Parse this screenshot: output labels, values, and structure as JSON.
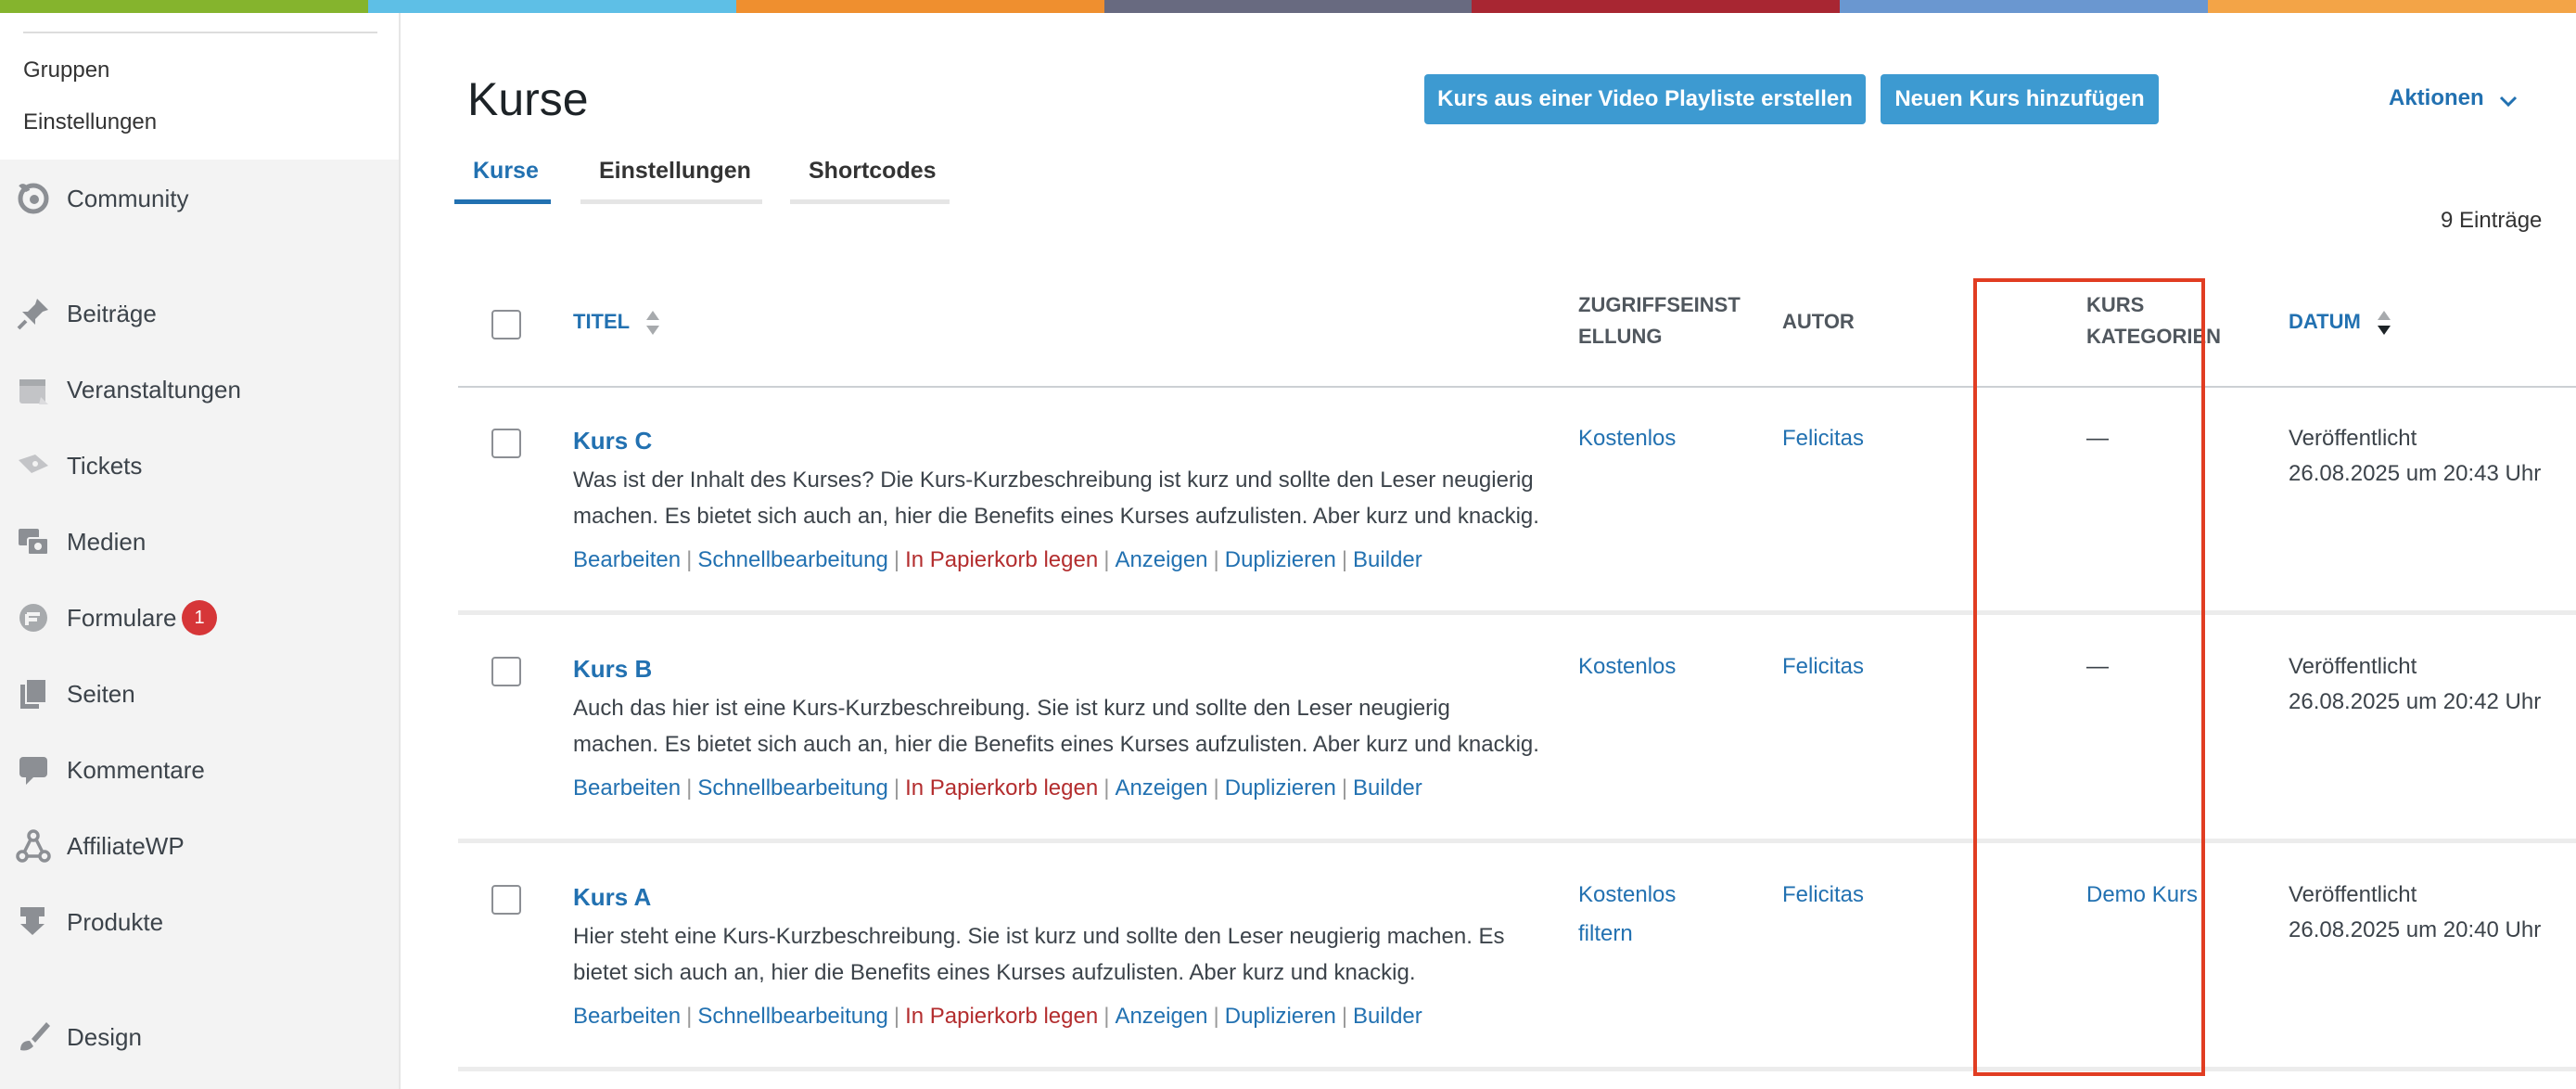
{
  "colors": {
    "topbar": [
      "#85b42d",
      "#5ebfe6",
      "#ef8f2f",
      "#686a80",
      "#a82632",
      "#6a97d0",
      "#f3a447"
    ],
    "accent": "#2271b1",
    "button": "#3d9ad1",
    "trash": "#b32d2e",
    "highlight_box": "#e13d22",
    "badge": "#d63638"
  },
  "sidebar": {
    "submenu": [
      "Gruppen",
      "Einstellungen"
    ],
    "items": [
      {
        "label": "Community",
        "icon": "buddyboss-icon"
      },
      {
        "label": "Beiträge",
        "icon": "pushpin-icon"
      },
      {
        "label": "Veranstaltungen",
        "icon": "calendar-icon"
      },
      {
        "label": "Tickets",
        "icon": "ticket-icon"
      },
      {
        "label": "Medien",
        "icon": "media-icon"
      },
      {
        "label": "Formulare",
        "icon": "forms-icon",
        "badge": "1"
      },
      {
        "label": "Seiten",
        "icon": "pages-icon"
      },
      {
        "label": "Kommentare",
        "icon": "comment-icon"
      },
      {
        "label": "AffiliateWP",
        "icon": "affiliate-icon"
      },
      {
        "label": "Produkte",
        "icon": "download-icon"
      },
      {
        "label": "Design",
        "icon": "brush-icon"
      }
    ]
  },
  "header": {
    "title": "Kurse",
    "btn_playlist": "Kurs aus einer Video Playliste erstellen",
    "btn_add": "Neuen Kurs hinzufügen",
    "actions": "Aktionen"
  },
  "tabs": [
    "Kurse",
    "Einstellungen",
    "Shortcodes"
  ],
  "entries_count": "9 Einträge",
  "table": {
    "headers": {
      "title": "TITEL",
      "access": [
        "ZUGRIFFSEINST",
        "ELLUNG"
      ],
      "author": "AUTOR",
      "categories": [
        "KURS",
        "KATEGORIEN"
      ],
      "date": "DATUM"
    },
    "row_actions": [
      "Bearbeiten",
      "Schnellbearbeitung",
      "In Papierkorb legen",
      "Anzeigen",
      "Duplizieren",
      "Builder"
    ],
    "rows": [
      {
        "title": "Kurs C",
        "desc": [
          "Was ist der Inhalt des Kurses? Die Kurs-Kurzbeschreibung ist kurz und sollte den Leser neugierig",
          "machen. Es bietet sich auch an, hier die Benefits eines Kurses aufzulisten. Aber kurz und knackig."
        ],
        "access": [
          "Kostenlos"
        ],
        "author": "Felicitas",
        "category": "—",
        "status": "Veröffentlicht",
        "date": "26.08.2025 um 20:43 Uhr"
      },
      {
        "title": "Kurs B",
        "desc": [
          "Auch das hier ist eine Kurs-Kurzbeschreibung. Sie ist kurz und sollte den Leser neugierig",
          "machen. Es bietet sich auch an, hier die Benefits eines Kurses aufzulisten. Aber kurz und knackig."
        ],
        "access": [
          "Kostenlos"
        ],
        "author": "Felicitas",
        "category": "—",
        "status": "Veröffentlicht",
        "date": "26.08.2025 um 20:42 Uhr"
      },
      {
        "title": "Kurs A",
        "desc": [
          "Hier steht eine Kurs-Kurzbeschreibung. Sie ist kurz und sollte den Leser neugierig machen. Es",
          "bietet sich auch an, hier die Benefits eines Kurses aufzulisten. Aber kurz und knackig."
        ],
        "access": [
          "Kostenlos",
          "filtern"
        ],
        "author": "Felicitas",
        "category": "Demo Kurs",
        "status": "Veröffentlicht",
        "date": "26.08.2025 um 20:40 Uhr"
      }
    ]
  }
}
